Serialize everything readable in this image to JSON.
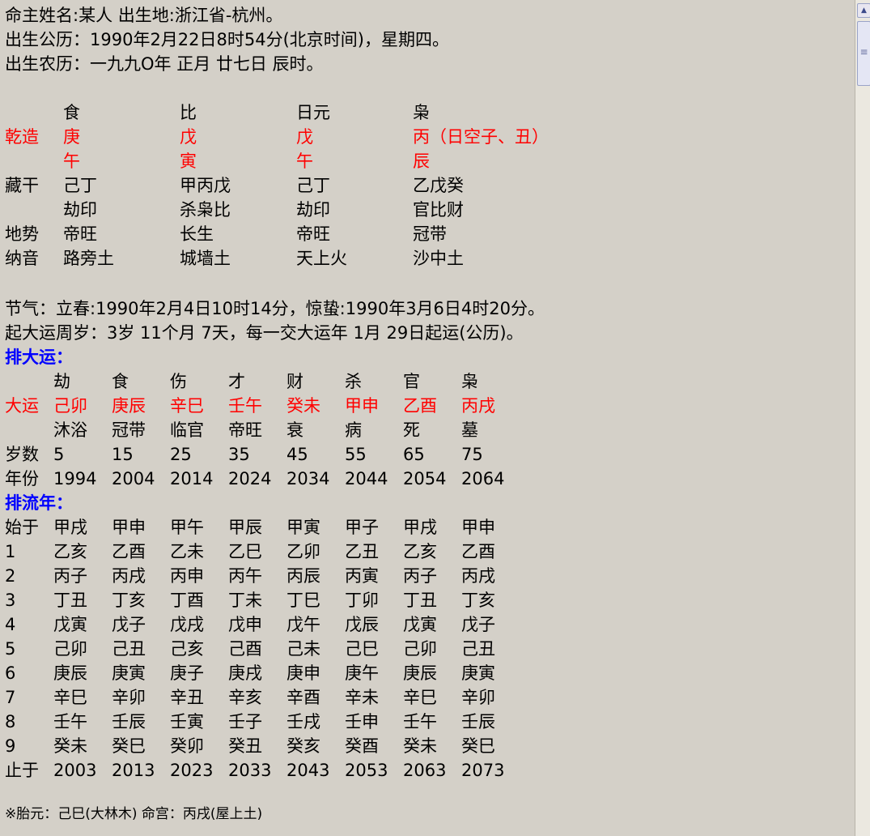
{
  "info": {
    "line1": "命主姓名:某人  出生地:浙江省-杭州。",
    "line2": "出生公历：1990年2月22日8时54分(北京时间)，星期四。",
    "line3": "出生农历：一九九O年 正月 廿七日 辰时。"
  },
  "chart": {
    "shishen": [
      "食",
      "比",
      "日元",
      "枭"
    ],
    "gan_label": "乾造",
    "gan": [
      "庚",
      "戊",
      "戊",
      "丙（日空子、丑）"
    ],
    "zhi": [
      "午",
      "寅",
      "午",
      "辰"
    ],
    "canggan_label": "藏干",
    "canggan": [
      "己丁",
      "甲丙戊",
      "己丁",
      "乙戊癸"
    ],
    "canggan_ss": [
      "劫印",
      "杀枭比",
      "劫印",
      "官比财"
    ],
    "dishi_label": "地势",
    "dishi": [
      "帝旺",
      "长生",
      "帝旺",
      "冠带"
    ],
    "nayin_label": "纳音",
    "nayin": [
      "路旁土",
      "城墙土",
      "天上火",
      "沙中土"
    ]
  },
  "jieqi": "节气：立春:1990年2月4日10时14分，惊蛰:1990年3月6日4时20分。",
  "qiyun": "起大运周岁：3岁 11个月 7天，每一交大运年 1月 29日起运(公历)。",
  "dayun": {
    "title": "排大运：",
    "shishen": [
      "劫",
      "食",
      "伤",
      "才",
      "财",
      "杀",
      "官",
      "枭"
    ],
    "label": "大运",
    "ganzhi": [
      "己卯",
      "庚辰",
      "辛巳",
      "壬午",
      "癸未",
      "甲申",
      "乙酉",
      "丙戌"
    ],
    "changsheng": [
      "沐浴",
      "冠带",
      "临官",
      "帝旺",
      "衰",
      "病",
      "死",
      "墓"
    ],
    "age_label": "岁数",
    "ages": [
      "5",
      "15",
      "25",
      "35",
      "45",
      "55",
      "65",
      "75"
    ],
    "year_label": "年份",
    "years": [
      "1994",
      "2004",
      "2014",
      "2024",
      "2034",
      "2044",
      "2054",
      "2064"
    ]
  },
  "liunian": {
    "title": "排流年：",
    "rows": [
      {
        "label": "始于",
        "cells": [
          "甲戌",
          "甲申",
          "甲午",
          "甲辰",
          "甲寅",
          "甲子",
          "甲戌",
          "甲申"
        ]
      },
      {
        "label": "1",
        "cells": [
          "乙亥",
          "乙酉",
          "乙未",
          "乙巳",
          "乙卯",
          "乙丑",
          "乙亥",
          "乙酉"
        ]
      },
      {
        "label": "2",
        "cells": [
          "丙子",
          "丙戌",
          "丙申",
          "丙午",
          "丙辰",
          "丙寅",
          "丙子",
          "丙戌"
        ]
      },
      {
        "label": "3",
        "cells": [
          "丁丑",
          "丁亥",
          "丁酉",
          "丁未",
          "丁巳",
          "丁卯",
          "丁丑",
          "丁亥"
        ]
      },
      {
        "label": "4",
        "cells": [
          "戊寅",
          "戊子",
          "戊戌",
          "戊申",
          "戊午",
          "戊辰",
          "戊寅",
          "戊子"
        ]
      },
      {
        "label": "5",
        "cells": [
          "己卯",
          "己丑",
          "己亥",
          "己酉",
          "己未",
          "己巳",
          "己卯",
          "己丑"
        ]
      },
      {
        "label": "6",
        "cells": [
          "庚辰",
          "庚寅",
          "庚子",
          "庚戌",
          "庚申",
          "庚午",
          "庚辰",
          "庚寅"
        ]
      },
      {
        "label": "7",
        "cells": [
          "辛巳",
          "辛卯",
          "辛丑",
          "辛亥",
          "辛酉",
          "辛未",
          "辛巳",
          "辛卯"
        ]
      },
      {
        "label": "8",
        "cells": [
          "壬午",
          "壬辰",
          "壬寅",
          "壬子",
          "壬戌",
          "壬申",
          "壬午",
          "壬辰"
        ]
      },
      {
        "label": "9",
        "cells": [
          "癸未",
          "癸巳",
          "癸卯",
          "癸丑",
          "癸亥",
          "癸酉",
          "癸未",
          "癸巳"
        ]
      },
      {
        "label": "止于",
        "cells": [
          "2003",
          "2013",
          "2023",
          "2033",
          "2043",
          "2053",
          "2063",
          "2073"
        ]
      }
    ]
  },
  "footer": "※胎元：己巳(大林木)  命宫：丙戌(屋上土)",
  "scrollbar": {
    "up_icon": "▲",
    "grip_icon": "≡"
  },
  "colors": {
    "accent_red": "#ff0000",
    "accent_blue": "#0000ff",
    "background": "#d4d0c8"
  }
}
